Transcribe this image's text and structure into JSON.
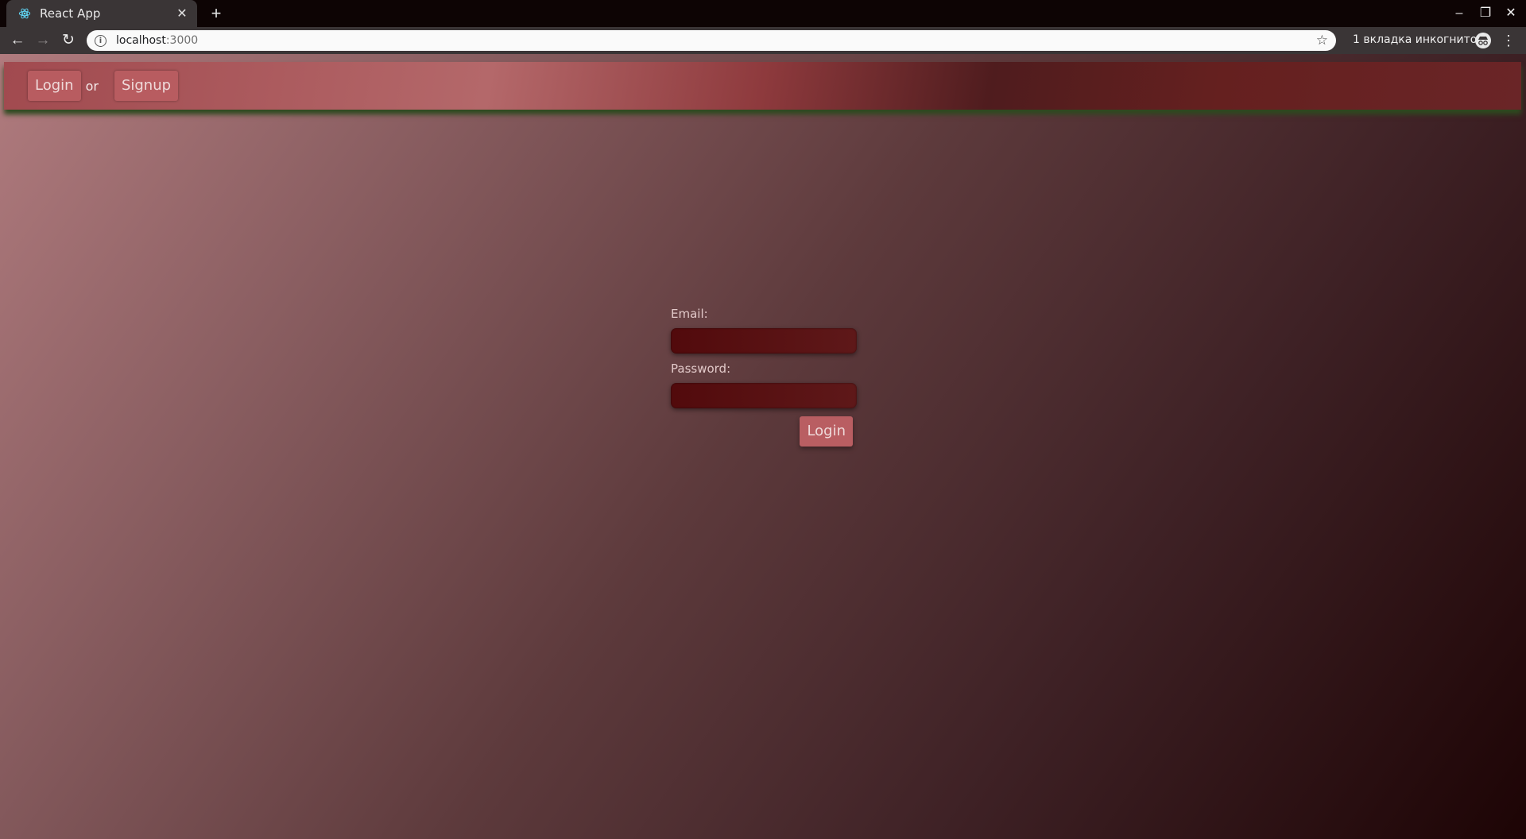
{
  "browser": {
    "tab_title": "React App",
    "tab_close": "✕",
    "new_tab": "+",
    "url_host": "localhost",
    "url_port": ":3000",
    "incognito_label": "1 вкладка инкогнито",
    "controls": {
      "minimize": "–",
      "restore": "❐",
      "close": "✕"
    },
    "nav": {
      "back": "←",
      "forward": "→",
      "reload": "↻"
    },
    "menu": "⋮"
  },
  "header": {
    "login_label": "Login",
    "or_text": "or",
    "signup_label": "Signup"
  },
  "form": {
    "email_label": "Email:",
    "email_value": "",
    "password_label": "Password:",
    "password_value": "",
    "submit_label": "Login"
  },
  "icons": {
    "favicon": "react-icon",
    "info": "info-icon",
    "bookmark": "star-icon",
    "incognito": "incognito-icon"
  },
  "colors": {
    "accent": "#b85c60",
    "header_shadow": "#2d4a1f",
    "input_bg": "#520a0c"
  }
}
